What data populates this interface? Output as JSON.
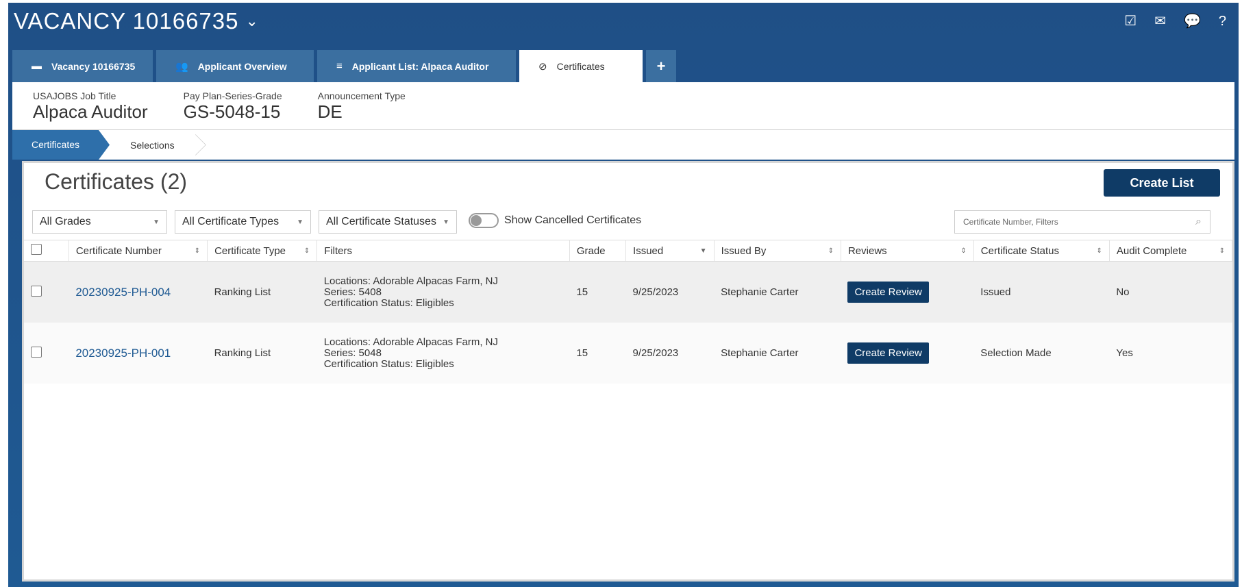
{
  "header": {
    "title": "VACANCY 10166735",
    "icons": [
      "checklist-icon",
      "inbox-icon",
      "chat-icon",
      "help-icon"
    ]
  },
  "tabs": [
    {
      "label": "Vacancy 10166735",
      "icon": "folder-icon"
    },
    {
      "label": "Applicant Overview",
      "icon": "people-icon"
    },
    {
      "label": "Applicant List: Alpaca Auditor",
      "icon": "list-icon"
    },
    {
      "label": "Certificates",
      "icon": "circle-check-icon"
    },
    {
      "label": "+",
      "icon": "plus-icon"
    }
  ],
  "info": {
    "job_title_label": "USAJOBS Job Title",
    "job_title_value": "Alpaca Auditor",
    "psg_label": "Pay Plan-Series-Grade",
    "psg_value": "GS-5048-15",
    "announcement_label": "Announcement Type",
    "announcement_value": "DE"
  },
  "breadcrumbs": {
    "active": "Certificates",
    "next": "Selections"
  },
  "panel": {
    "title": "Certificates (2)",
    "create_list": "Create List"
  },
  "filters": {
    "grades": "All Grades",
    "types": "All Certificate Types",
    "statuses": "All Certificate Statuses",
    "show_cancelled": "Show Cancelled Certificates",
    "search_placeholder": "Certificate Number, Filters"
  },
  "table": {
    "columns": [
      "Certificate Number",
      "Certificate Type",
      "Filters",
      "Grade",
      "Issued",
      "Issued By",
      "Reviews",
      "Certificate Status",
      "Audit Complete"
    ],
    "rows": [
      {
        "number": "20230925-PH-004",
        "type": "Ranking List",
        "filters": [
          "Locations: Adorable Alpacas Farm, NJ",
          "Series: 5408",
          "Certification Status: Eligibles"
        ],
        "grade": "15",
        "issued": "9/25/2023",
        "issued_by": "Stephanie Carter",
        "review": "Create Review",
        "status": "Issued",
        "audit": "No"
      },
      {
        "number": "20230925-PH-001",
        "type": "Ranking List",
        "filters": [
          "Locations: Adorable Alpacas Farm, NJ",
          "Series: 5048",
          "Certification Status: Eligibles"
        ],
        "grade": "15",
        "issued": "9/25/2023",
        "issued_by": "Stephanie Carter",
        "review": "Create Review",
        "status": "Selection Made",
        "audit": "Yes"
      }
    ]
  }
}
